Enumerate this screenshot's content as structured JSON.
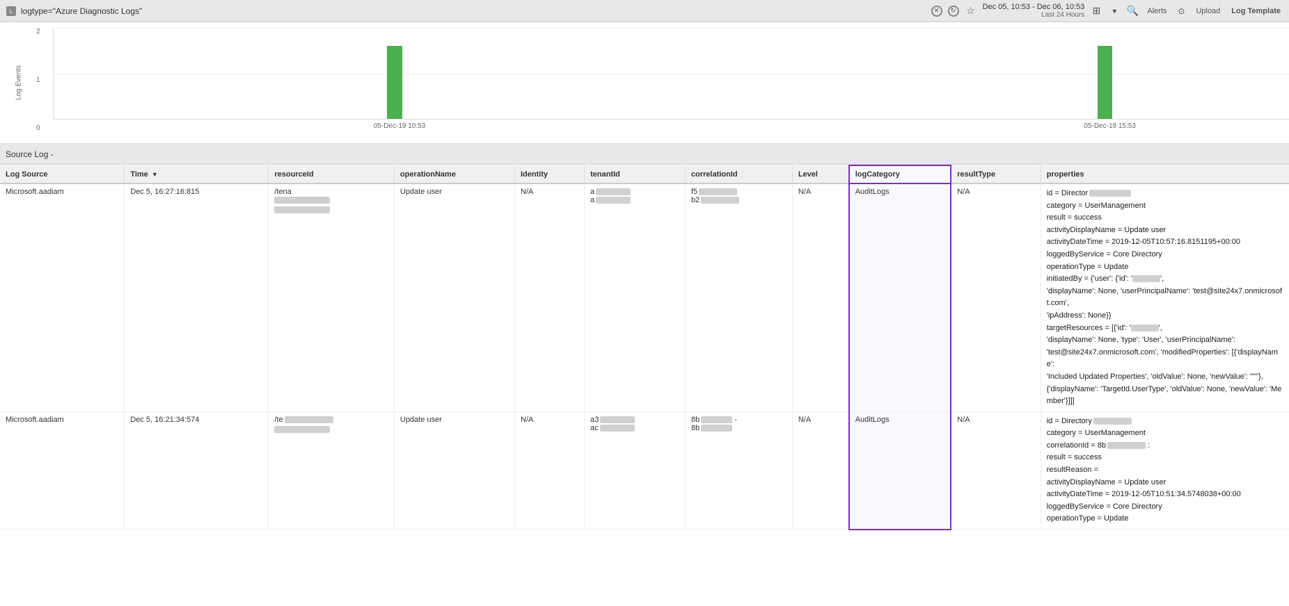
{
  "toolbar": {
    "query": "logtype=\"Azure Diagnostic Logs\"",
    "datetime": "Dec 05, 10:53 - Dec 06, 10:53",
    "datetime_sub": "Last 24 Hours",
    "alerts_label": "Alerts",
    "upload_label": "Upload",
    "log_template_label": "Log Template"
  },
  "chart": {
    "y_label": "Log Events",
    "y_ticks": [
      "0",
      "1",
      "2"
    ],
    "bars": [
      {
        "x_pct": 28,
        "height_pct": 85,
        "label": ""
      },
      {
        "x_pct": 86,
        "height_pct": 85,
        "label": ""
      }
    ],
    "x_labels": [
      {
        "x_pct": 28,
        "text": "05-Dec-19 10:53"
      },
      {
        "x_pct": 86,
        "text": "05-Dec-19 15:53"
      }
    ]
  },
  "source_log": "Source Log -",
  "table": {
    "columns": [
      {
        "id": "logSource",
        "label": "Log Source",
        "sort": false
      },
      {
        "id": "time",
        "label": "Time",
        "sort": true
      },
      {
        "id": "resourceId",
        "label": "resourceId",
        "sort": false
      },
      {
        "id": "operationName",
        "label": "operationName",
        "sort": false
      },
      {
        "id": "identity",
        "label": "Identity",
        "sort": false
      },
      {
        "id": "tenantId",
        "label": "tenantId",
        "sort": false
      },
      {
        "id": "correlationId",
        "label": "correlationId",
        "sort": false
      },
      {
        "id": "level",
        "label": "Level",
        "sort": false
      },
      {
        "id": "logCategory",
        "label": "logCategory",
        "sort": false,
        "highlighted": true
      },
      {
        "id": "resultType",
        "label": "resultType",
        "sort": false
      },
      {
        "id": "properties",
        "label": "properties",
        "sort": false
      }
    ],
    "rows": [
      {
        "logSource": "Microsoft.aadiam",
        "time": "Dec 5, 16:27:16:815",
        "resourceId": "/tena",
        "resourceId_redacted": true,
        "operationName": "Update user",
        "identity": "N/A",
        "tenantId_line1": "a",
        "tenantId_line2": "a",
        "tenantId_redacted": true,
        "correlationId_line1": "f5",
        "correlationId_line2": "b2",
        "correlationId_redacted": true,
        "level": "N/A",
        "logCategory": "AuditLogs",
        "resultType": "N/A",
        "properties": [
          "id = Director",
          "category = UserManagement",
          "result = success",
          "activityDisplayName = Update user",
          "activityDateTime = 2019-12-05T10:57:16.8151195+00:00",
          "loggedByService = Core Directory",
          "operationType = Update",
          "initiatedBy = {'user': {'id': '...',",
          "'displayName': None, 'userPrincipalName': 'test@site24x7.onmicrosoft.com',",
          "'ipAddress': None}}",
          "targetResources = [{'id': '...', ",
          "'displayName': None, 'type': 'User', 'userPrincipalName':",
          "'test@site24x7.onmicrosoft.com', 'modifiedProperties': [{'displayName':",
          "'Included Updated Properties', 'oldValue': None, 'newValue': '\"\"'},",
          "{'displayName': 'TargetId.UserType', 'oldValue': None, 'newValue': 'Member'}]]]"
        ]
      },
      {
        "logSource": "Microsoft.aadiam",
        "time": "Dec 5, 16:21:34:574",
        "resourceId": "/te",
        "resourceId_redacted": true,
        "operationName": "Update user",
        "identity": "N/A",
        "tenantId_line1": "a3",
        "tenantId_line2": "ac",
        "tenantId_redacted": true,
        "correlationId_line1": "8b",
        "correlationId_line2": "8b",
        "correlationId_dash": "-",
        "correlationId_redacted": true,
        "level": "N/A",
        "logCategory": "AuditLogs",
        "resultType": "N/A",
        "properties": [
          "id = Directory",
          "category = UserManagement",
          "correlationId = 8b",
          "result = success",
          "resultReason =",
          "activityDisplayName = Update user",
          "activityDateTime = 2019-12-05T10:51:34.5748038+00:00",
          "loggedByService = Core Directory",
          "operationType = Update"
        ]
      }
    ]
  }
}
